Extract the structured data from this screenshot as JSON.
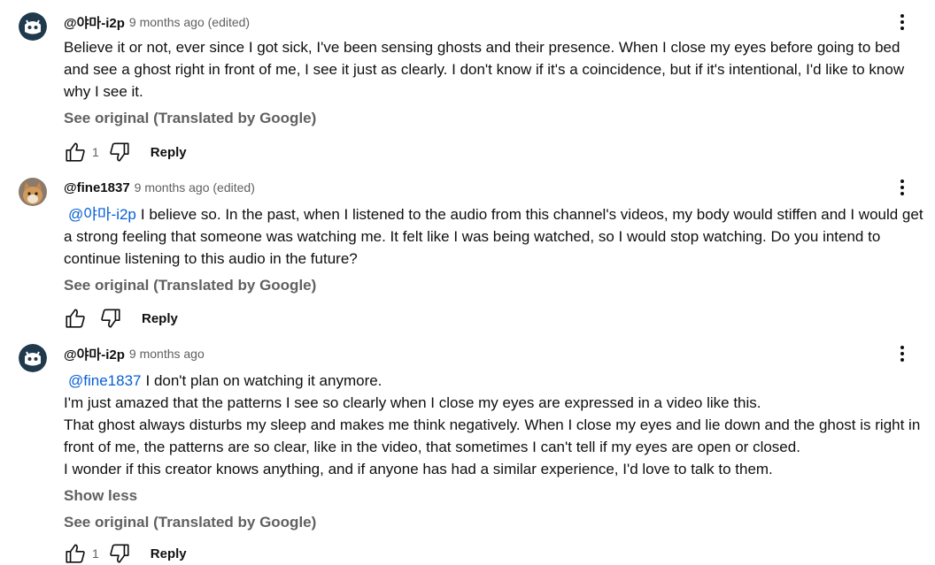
{
  "comments": [
    {
      "author": "@야마-i2p",
      "meta": "9 months ago (edited)",
      "avatar_icon": "robot-face-icon",
      "mention": "",
      "lines": [
        "Believe it or not, ever since I got sick, I've been sensing ghosts and their presence. When I close my eyes before going to bed and see a ghost right in front of me, I see it just as clearly. I don't know if it's a coincidence, but if it's intentional, I'd like to know why I see it."
      ],
      "see_original": "See original (Translated by Google)",
      "like_count": "1",
      "reply_label": "Reply"
    },
    {
      "author": "@fine1837",
      "meta": "9 months ago (edited)",
      "avatar_icon": "cat-photo-avatar",
      "mention": "@야마-i2p",
      "lines": [
        "I believe so. In the past, when I listened to the audio from this channel's videos, my body would stiffen and I would get a strong feeling that someone was watching me. It felt like I was being watched, so I would stop watching. Do you intend to continue listening to this audio in the future?"
      ],
      "see_original": "See original (Translated by Google)",
      "like_count": "",
      "reply_label": "Reply"
    },
    {
      "author": "@야마-i2p",
      "meta": "9 months ago",
      "avatar_icon": "robot-face-icon",
      "mention": "@fine1837",
      "lines": [
        "I don't plan on watching it anymore.",
        "I'm just amazed that the patterns I see so clearly when I close my eyes are expressed in a video like this.",
        "That ghost always disturbs my sleep and makes me think negatively. When I close my eyes and lie down and the ghost is right in front of me, the patterns are so clear, like in the video, that sometimes I can't tell if my eyes are open or closed.",
        "I wonder if this creator knows anything, and if anyone has had a similar experience, I'd love to talk to them."
      ],
      "show_less": "Show less",
      "see_original": "See original (Translated by Google)",
      "like_count": "1",
      "reply_label": "Reply"
    }
  ]
}
